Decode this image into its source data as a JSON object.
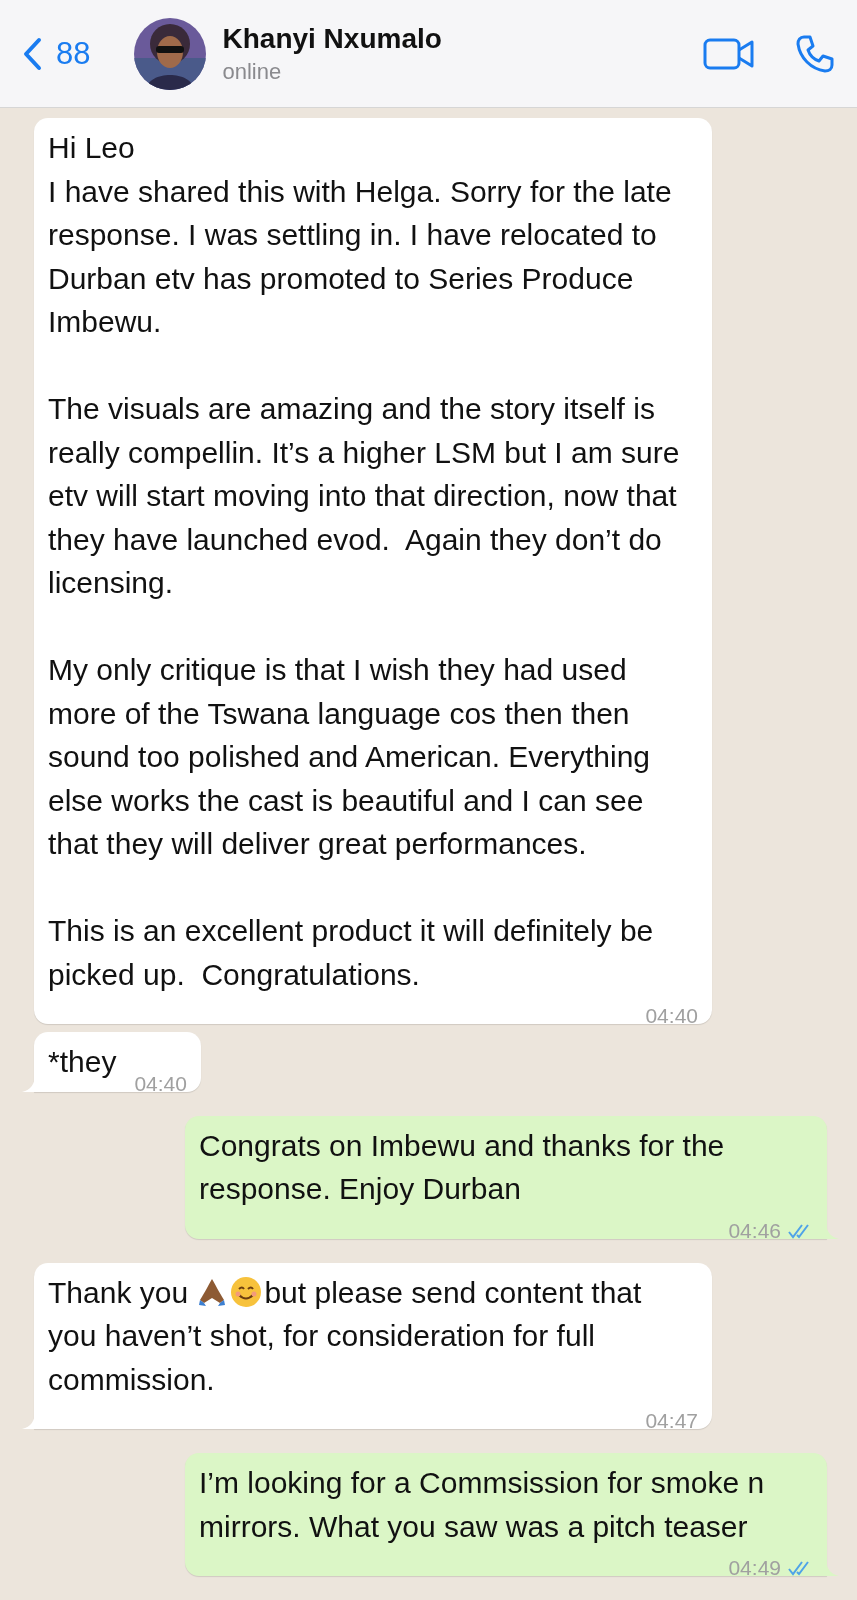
{
  "header": {
    "back_count": "88",
    "contact_name": "Khanyi Nxumalo",
    "status": "online"
  },
  "messages": [
    {
      "kind": "in",
      "tail": false,
      "parts": [
        {
          "kind": "text",
          "text": "Hi Leo\nI have shared this with Helga. Sorry for the late response. I was settling in. I have relocated to Durban etv has promoted to Series Produce Imbewu.\n\nThe visuals are amazing and the story itself is really compellin. It’s a higher LSM but I am sure etv will start moving into that direction, now that they have launched evod.  Again they don’t do licensing.\n\nMy only critique is that I wish they had used more of the Tswana language cos then then sound too polished and American. Everything else works the cast is beautiful and I can see that they will deliver great performances.\n\nThis is an excellent product it will definitely be picked up.  Congratulations."
        }
      ],
      "time": "04:40"
    },
    {
      "kind": "in",
      "tail": true,
      "parts": [
        {
          "kind": "text",
          "text": "*they"
        }
      ],
      "time": "04:40"
    },
    {
      "kind": "out",
      "tail": true,
      "read": true,
      "parts": [
        {
          "kind": "text",
          "text": "Congrats on Imbewu and thanks for the response. Enjoy Durban"
        }
      ],
      "time": "04:46"
    },
    {
      "kind": "in",
      "tail": true,
      "parts": [
        {
          "kind": "text",
          "text": "Thank you "
        },
        {
          "kind": "pray"
        },
        {
          "kind": "smile"
        },
        {
          "kind": "text",
          "text": "but please send content that you haven’t shot, for consideration for full commission."
        }
      ],
      "time": "04:47"
    },
    {
      "kind": "out",
      "tail": true,
      "read": true,
      "parts": [
        {
          "kind": "text",
          "text": "I’m looking for a Commsission for smoke n mirrors. What you saw was a pitch teaser"
        }
      ],
      "time": "04:49"
    }
  ]
}
